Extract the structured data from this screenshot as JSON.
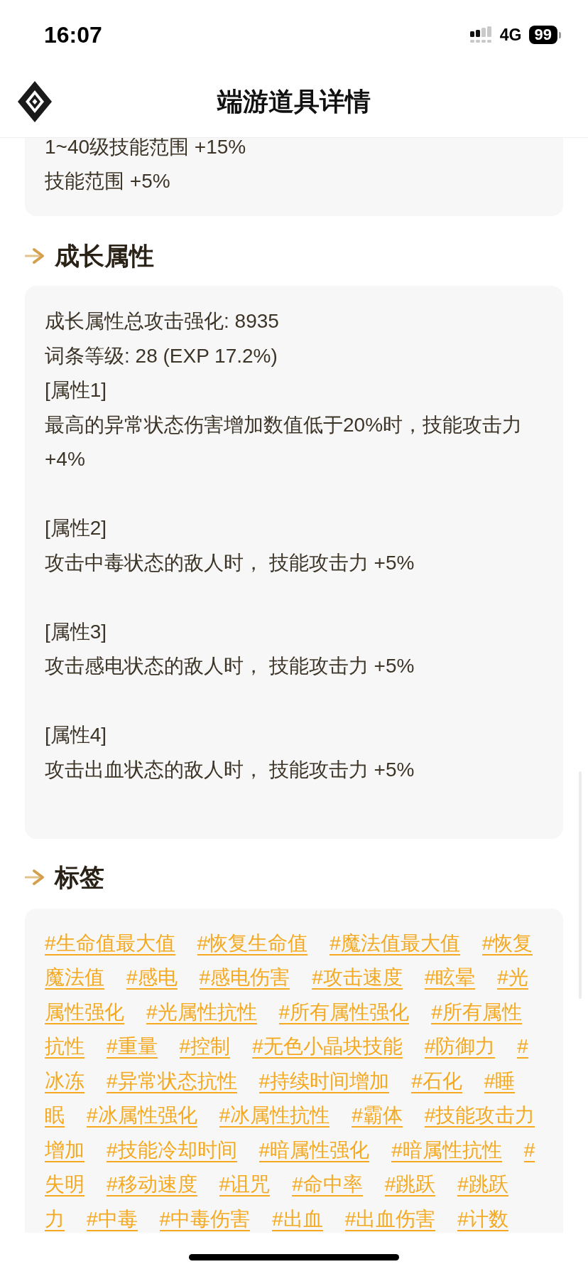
{
  "status_bar": {
    "time": "16:07",
    "network": "4G",
    "battery": "99"
  },
  "header": {
    "title": "端游道具详情"
  },
  "skill_effects": {
    "lines": [
      "1~40级技能范围 +15%",
      "技能范围 +5%"
    ]
  },
  "growth_attributes": {
    "title": "成长属性",
    "summary": [
      "成长属性总攻击强化: 8935",
      "词条等级: 28 (EXP 17.2%)"
    ],
    "attributes": [
      {
        "label": "[属性1]",
        "text": "最高的异常状态伤害增加数值低于20%时，技能攻击力 +4%"
      },
      {
        "label": "[属性2]",
        "text": "攻击中毒状态的敌人时， 技能攻击力 +5%"
      },
      {
        "label": "[属性3]",
        "text": "攻击感电状态的敌人时， 技能攻击力 +5%"
      },
      {
        "label": "[属性4]",
        "text": "攻击出血状态的敌人时， 技能攻击力 +5%"
      }
    ]
  },
  "tags_section": {
    "title": "标签",
    "tags": [
      {
        "lines": [
          "#生命值最大值"
        ]
      },
      {
        "lines": [
          "#恢复生命值"
        ]
      },
      {
        "lines": [
          "#魔法值最大值"
        ]
      },
      {
        "lines": [
          "#恢复",
          "魔法值"
        ]
      },
      {
        "lines": [
          "#感电"
        ]
      },
      {
        "lines": [
          "#感电伤害"
        ]
      },
      {
        "lines": [
          "#攻击速度"
        ]
      },
      {
        "lines": [
          "#眩晕"
        ]
      },
      {
        "lines": [
          "#光",
          "属性强化"
        ]
      },
      {
        "lines": [
          "#光属性抗性"
        ]
      },
      {
        "lines": [
          "#所有属性强化"
        ]
      },
      {
        "lines": [
          "#所有属性",
          "抗性"
        ]
      },
      {
        "lines": [
          "#重量"
        ]
      },
      {
        "lines": [
          "#控制"
        ]
      },
      {
        "lines": [
          "#无色小晶块技能"
        ]
      },
      {
        "lines": [
          "#防御力"
        ]
      },
      {
        "lines": [
          "#",
          "冰冻"
        ]
      },
      {
        "lines": [
          "#异常状态抗性"
        ]
      },
      {
        "lines": [
          "#持续时间增加"
        ]
      },
      {
        "lines": [
          "#石化"
        ]
      },
      {
        "lines": [
          "#睡",
          "眠"
        ]
      },
      {
        "lines": [
          "#冰属性强化"
        ]
      },
      {
        "lines": [
          "#冰属性抗性"
        ]
      },
      {
        "lines": [
          "#霸体"
        ]
      },
      {
        "lines": [
          "#技能攻击力",
          "增加"
        ]
      },
      {
        "lines": [
          "#技能冷却时间"
        ]
      },
      {
        "lines": [
          "#暗属性强化"
        ]
      },
      {
        "lines": [
          "#暗属性抗性"
        ]
      },
      {
        "lines": [
          "#",
          "失明"
        ]
      },
      {
        "lines": [
          "#移动速度"
        ]
      },
      {
        "lines": [
          "#诅咒"
        ]
      },
      {
        "lines": [
          "#命中率"
        ]
      },
      {
        "lines": [
          "#跳跃"
        ]
      },
      {
        "lines": [
          "#跳跃",
          "力"
        ]
      },
      {
        "lines": [
          "#中毒"
        ]
      },
      {
        "lines": [
          "#中毒伤害"
        ]
      },
      {
        "lines": [
          "#出血"
        ]
      },
      {
        "lines": [
          "#出血伤害"
        ]
      },
      {
        "lines": [
          "#计数"
        ]
      }
    ]
  }
}
